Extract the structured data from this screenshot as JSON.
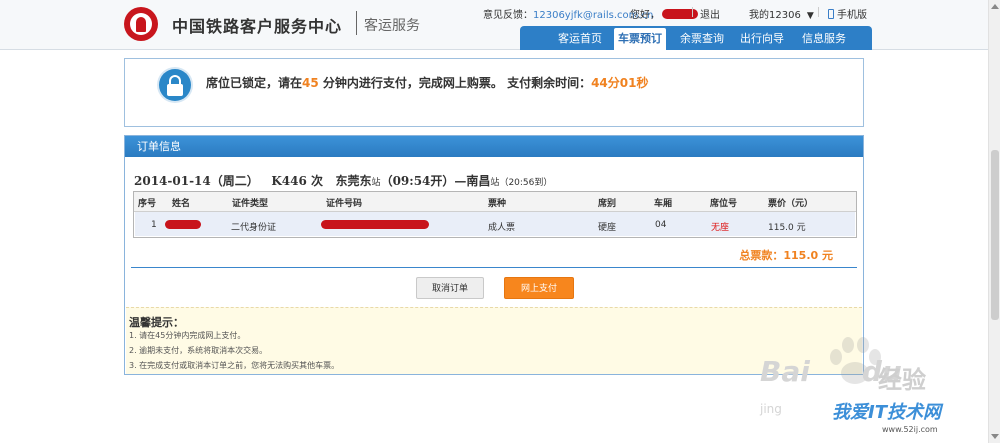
{
  "header": {
    "brand": "中国铁路客户服务中心",
    "brand_sub": "客运服务",
    "feedback_label": "意见反馈：",
    "feedback_email": "12306yjfk@rails.com.cn",
    "greeting": "您好，",
    "logout": "退出",
    "my12306": "我的12306",
    "mobile": "手机版",
    "nav": [
      "客运首页",
      "车票预订",
      "余票查询",
      "出行向导",
      "信息服务"
    ]
  },
  "notice": {
    "text_1": "席位已锁定，请在",
    "minutes": "45",
    "text_2": " 分钟内进行支付，完成网上购票。 支付剩余时间：",
    "remaining": "44分01秒"
  },
  "order": {
    "panel_title": "订单信息",
    "date": "2014-01-14（周二）",
    "train": "K446 次",
    "from": "东莞东",
    "station_suffix": "站",
    "depart": "（09:54开）—",
    "to": "南昌",
    "arrive": "（20:56到）",
    "columns": [
      "序号",
      "姓名",
      "证件类型",
      "证件号码",
      "票种",
      "席别",
      "车厢",
      "席位号",
      "票价（元）"
    ],
    "row": {
      "index": "1",
      "id_type": "二代身份证",
      "ticket_type": "成人票",
      "seat_class": "硬座",
      "car": "04",
      "seat_no": "无座",
      "price": "115.0 元"
    },
    "total": "总票款：115.0 元",
    "cancel_button": "取消订单",
    "pay_button": "网上支付"
  },
  "tips": {
    "title": "温馨提示：",
    "items": [
      "1.  请在45分钟内完成网上支付。",
      "2.  逾期未支付，系统将取消本次交易。",
      "3.  在完成支付或取消本订单之前，您将无法购买其他车票。"
    ]
  },
  "watermark": {
    "baidu": "Bai",
    "du": "du",
    "jingyan": "经验",
    "jing": "jing",
    "site": "我爱IT技术网",
    "url": "www.52ij.com"
  },
  "colors": {
    "accent": "#2d7fc7",
    "orange": "#f08220",
    "red": "#c8141c"
  }
}
